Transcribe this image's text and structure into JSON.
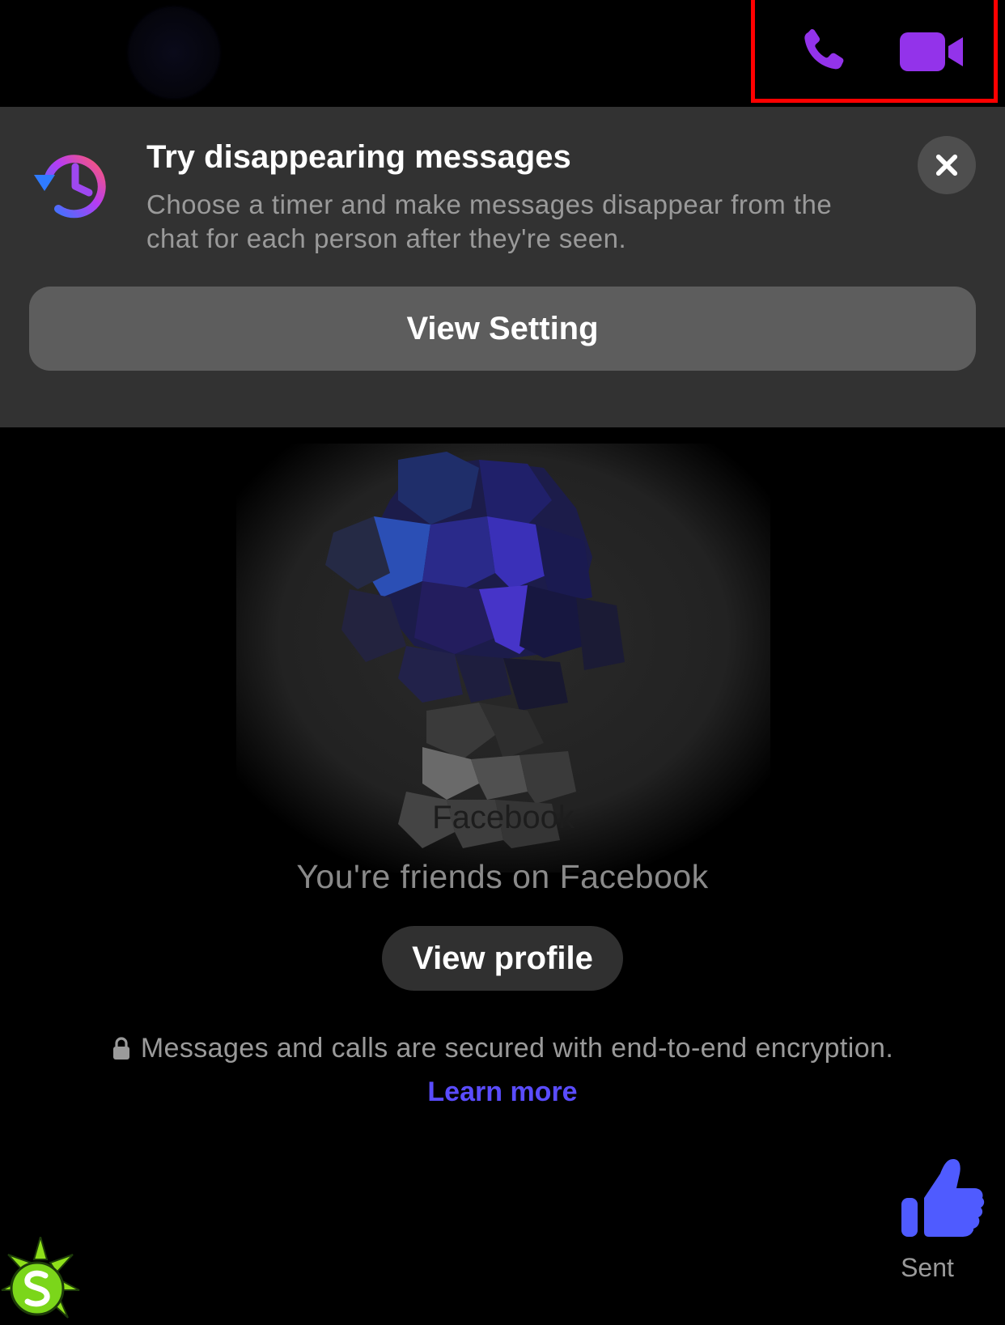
{
  "header": {
    "call_icon": "phone-icon",
    "video_icon": "video-camera-icon",
    "accent_color": "#9333ea"
  },
  "banner": {
    "title": "Try disappearing messages",
    "description": "Choose a timer and make messages disappear from the chat for each person after they're seen.",
    "button_label": "View Setting",
    "icon": "timer-history-icon",
    "close_icon": "close-icon"
  },
  "chat": {
    "profile_overlay_text": "Facebook",
    "friends_text": "You're friends on Facebook",
    "view_profile_label": "View profile",
    "encryption_text": "Messages and calls are secured with end-to-end encryption.",
    "learn_more_label": "Learn more",
    "link_color": "#5a4cff"
  },
  "composer": {
    "like_icon": "thumbs-up-icon",
    "sent_label": "Sent",
    "like_color": "#4f5bff"
  }
}
